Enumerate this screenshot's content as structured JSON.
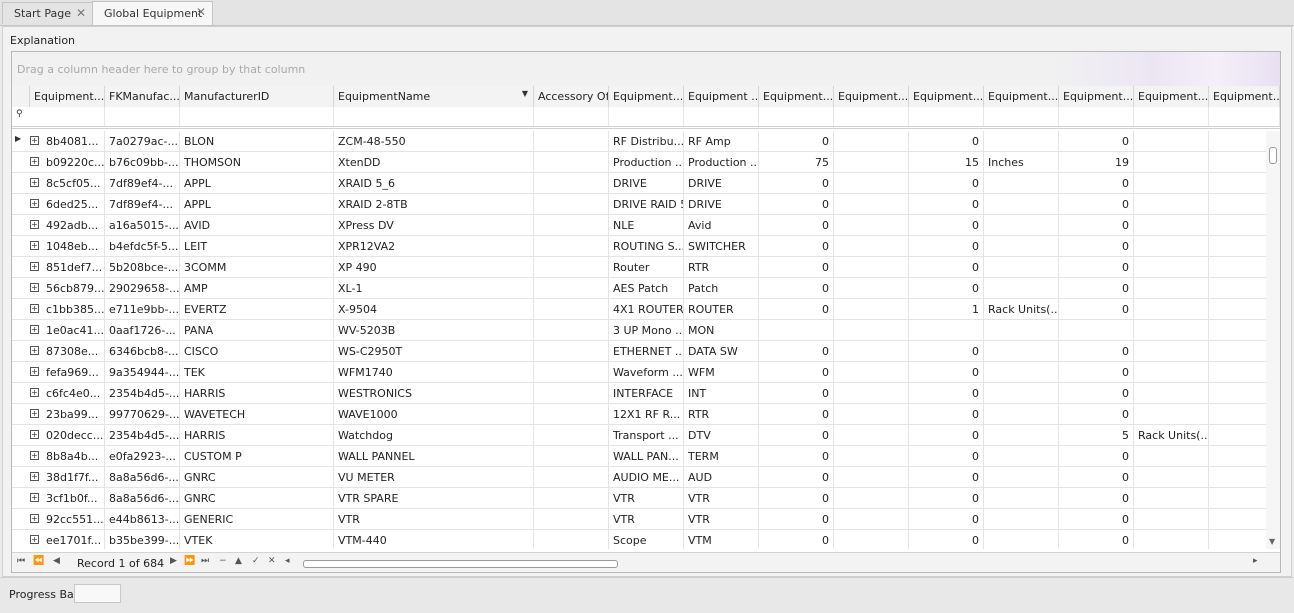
{
  "tabs": [
    {
      "label": "Start Page",
      "active": false
    },
    {
      "label": "Global Equipment",
      "active": true
    }
  ],
  "panel_caption": "Explanation",
  "group_panel_hint": "Drag a column header here to group by that column",
  "columns": [
    "Equipment...",
    "FKManufac...",
    "ManufacturerID",
    "EquipmentName",
    "Accessory Of",
    "Equipment...",
    "Equipment ...",
    "Equipment...",
    "Equipment...",
    "Equipment...",
    "Equipment...",
    "Equipment...",
    "Equipment...",
    "Equipment..."
  ],
  "rows": [
    {
      "c": [
        "8b4081...",
        "7a0279ac-...",
        "BLON",
        "ZCM-48-550",
        "",
        "RF Distribu...",
        "RF Amp",
        "0",
        "",
        "0",
        "",
        "0",
        "",
        ""
      ]
    },
    {
      "c": [
        "b09220c...",
        "b76c09bb-...",
        "THOMSON",
        "XtenDD",
        "",
        "Production ...",
        "Production ...",
        "75",
        "",
        "15",
        "Inches",
        "19",
        "",
        ""
      ]
    },
    {
      "c": [
        "8c5cf05...",
        "7df89ef4-...",
        "APPL",
        "XRAID 5_6",
        "",
        "DRIVE",
        "DRIVE",
        "0",
        "",
        "0",
        "",
        "0",
        "",
        ""
      ]
    },
    {
      "c": [
        "6ded25...",
        "7df89ef4-...",
        "APPL",
        "XRAID 2-8TB",
        "",
        "DRIVE RAID 5",
        "DRIVE",
        "0",
        "",
        "0",
        "",
        "0",
        "",
        ""
      ]
    },
    {
      "c": [
        "492adb...",
        "a16a5015-...",
        "AVID",
        "XPress DV",
        "",
        "NLE",
        "Avid",
        "0",
        "",
        "0",
        "",
        "0",
        "",
        ""
      ]
    },
    {
      "c": [
        "1048eb...",
        "b4efdc5f-5...",
        "LEIT",
        "XPR12VA2",
        "",
        "ROUTING S...",
        "SWITCHER",
        "0",
        "",
        "0",
        "",
        "0",
        "",
        ""
      ]
    },
    {
      "c": [
        "851def7...",
        "5b208bce-...",
        "3COMM",
        "XP 490",
        "",
        "Router",
        "RTR",
        "0",
        "",
        "0",
        "",
        "0",
        "",
        ""
      ]
    },
    {
      "c": [
        "56cb879...",
        "29029658-...",
        "AMP",
        "XL-1",
        "",
        "AES Patch",
        "Patch",
        "0",
        "",
        "0",
        "",
        "0",
        "",
        ""
      ]
    },
    {
      "c": [
        "c1bb385...",
        "e711e9bb-...",
        "EVERTZ",
        "X-9504",
        "",
        "4X1 ROUTER",
        "ROUTER",
        "0",
        "",
        "1",
        "Rack Units(...",
        "0",
        "",
        ""
      ]
    },
    {
      "c": [
        "1e0ac41...",
        "0aaf1726-...",
        "PANA",
        "WV-5203B",
        "",
        "3 UP Mono ...",
        "MON",
        "",
        "",
        "",
        "",
        "",
        "",
        ""
      ]
    },
    {
      "c": [
        "87308e...",
        "6346bcb8-...",
        "CISCO",
        "WS-C2950T",
        "",
        "ETHERNET ...",
        "DATA SW",
        "0",
        "",
        "0",
        "",
        "0",
        "",
        ""
      ]
    },
    {
      "c": [
        "fefa969...",
        "9a354944-...",
        "TEK",
        "WFM1740",
        "",
        "Waveform ...",
        "WFM",
        "0",
        "",
        "0",
        "",
        "0",
        "",
        ""
      ]
    },
    {
      "c": [
        "c6fc4e0...",
        "2354b4d5-...",
        "HARRIS",
        "WESTRONICS",
        "",
        "INTERFACE",
        "INT",
        "0",
        "",
        "0",
        "",
        "0",
        "",
        ""
      ]
    },
    {
      "c": [
        "23ba99...",
        "99770629-...",
        "WAVETECH",
        "WAVE1000",
        "",
        "12X1 RF R...",
        "RTR",
        "0",
        "",
        "0",
        "",
        "0",
        "",
        ""
      ]
    },
    {
      "c": [
        "020decc...",
        "2354b4d5-...",
        "HARRIS",
        "Watchdog",
        "",
        "Transport ...",
        "DTV",
        "0",
        "",
        "0",
        "",
        "5",
        "Rack Units(...",
        ""
      ]
    },
    {
      "c": [
        "8b8a4b...",
        "e0fa2923-...",
        "CUSTOM P",
        "WALL PANNEL",
        "",
        "WALL PAN...",
        "TERM",
        "0",
        "",
        "0",
        "",
        "0",
        "",
        ""
      ]
    },
    {
      "c": [
        "38d1f7f...",
        "8a8a56d6-...",
        "GNRC",
        "VU METER",
        "",
        "AUDIO ME...",
        "AUD",
        "0",
        "",
        "0",
        "",
        "0",
        "",
        ""
      ]
    },
    {
      "c": [
        "3cf1b0f...",
        "8a8a56d6-...",
        "GNRC",
        "VTR SPARE",
        "",
        "VTR",
        "VTR",
        "0",
        "",
        "0",
        "",
        "0",
        "",
        ""
      ]
    },
    {
      "c": [
        "92cc551...",
        "e44b8613-...",
        "GENERIC",
        "VTR",
        "",
        "VTR",
        "VTR",
        "0",
        "",
        "0",
        "",
        "0",
        "",
        ""
      ]
    },
    {
      "c": [
        "ee1701f...",
        "b35be399-...",
        "VTEK",
        "VTM-440",
        "",
        "Scope",
        "VTM",
        "0",
        "",
        "0",
        "",
        "0",
        "",
        ""
      ]
    }
  ],
  "navigator": {
    "record_text": "Record 1 of 684"
  },
  "status": {
    "progress_label": "Progress Bar"
  }
}
